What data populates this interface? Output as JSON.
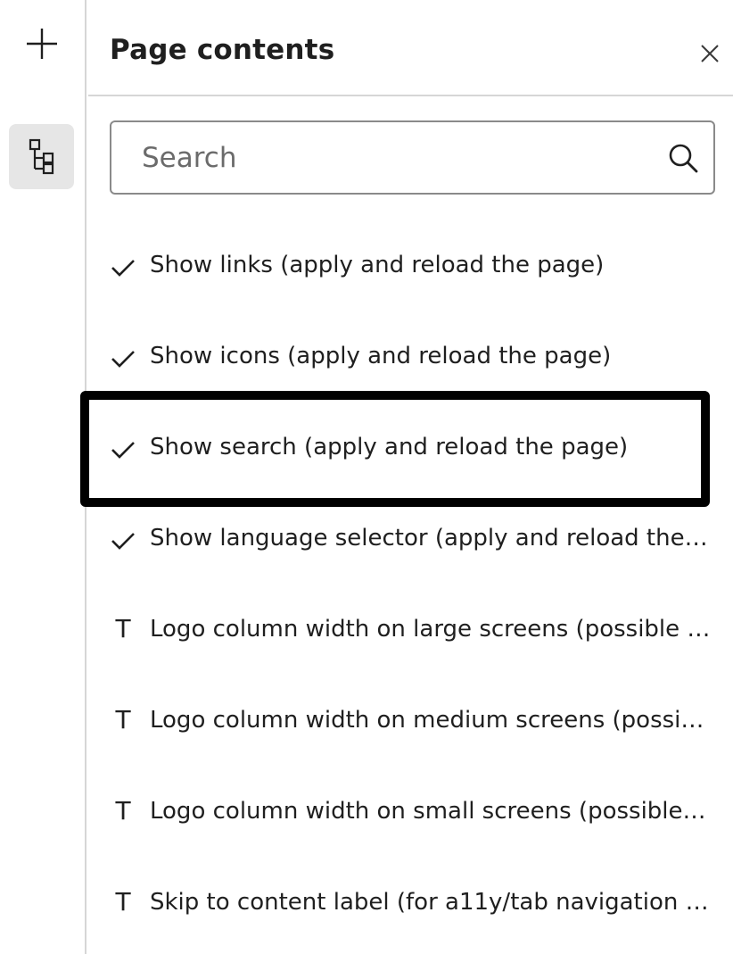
{
  "rail": {
    "add_icon": "plus-icon",
    "tree_icon": "page-tree-icon"
  },
  "panel": {
    "title": "Page contents",
    "close_icon": "close-icon"
  },
  "search": {
    "placeholder": "Search",
    "value": "",
    "icon": "search-icon"
  },
  "items": [
    {
      "icon": "check-icon",
      "label": "Show links (apply and reload the page)"
    },
    {
      "icon": "check-icon",
      "label": "Show icons (apply and reload the page)"
    },
    {
      "icon": "check-icon",
      "label": "Show search (apply and reload the page)"
    },
    {
      "icon": "check-icon",
      "label": "Show language selector (apply and reload the…"
    },
    {
      "icon": "text-icon",
      "glyph": "T",
      "label": "Logo column width on large screens (possible …"
    },
    {
      "icon": "text-icon",
      "glyph": "T",
      "label": "Logo column width on medium screens (possi…"
    },
    {
      "icon": "text-icon",
      "glyph": "T",
      "label": "Logo column width on small screens (possible …"
    },
    {
      "icon": "text-icon",
      "glyph": "T",
      "label": "Skip to content label (for a11y/tab navigation …"
    }
  ],
  "colors": {
    "highlight_border": "#000000",
    "rail_active_bg": "#e6e6e6",
    "divider": "#d6d6d6"
  }
}
